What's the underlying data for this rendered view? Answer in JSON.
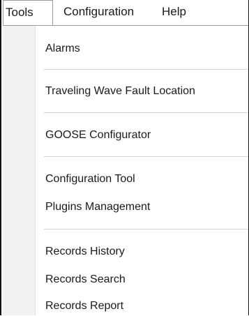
{
  "menubar": {
    "items": [
      {
        "label": "Tools"
      },
      {
        "label": "Configuration"
      },
      {
        "label": "Help"
      }
    ]
  },
  "tools_menu": {
    "items": [
      {
        "label": "Alarms"
      },
      {
        "label": "Traveling Wave Fault Location"
      },
      {
        "label": "GOOSE Configurator"
      },
      {
        "label": "Configuration Tool"
      },
      {
        "label": "Plugins Management"
      },
      {
        "label": "Records History"
      },
      {
        "label": "Records Search"
      },
      {
        "label": "Records Report"
      }
    ]
  }
}
